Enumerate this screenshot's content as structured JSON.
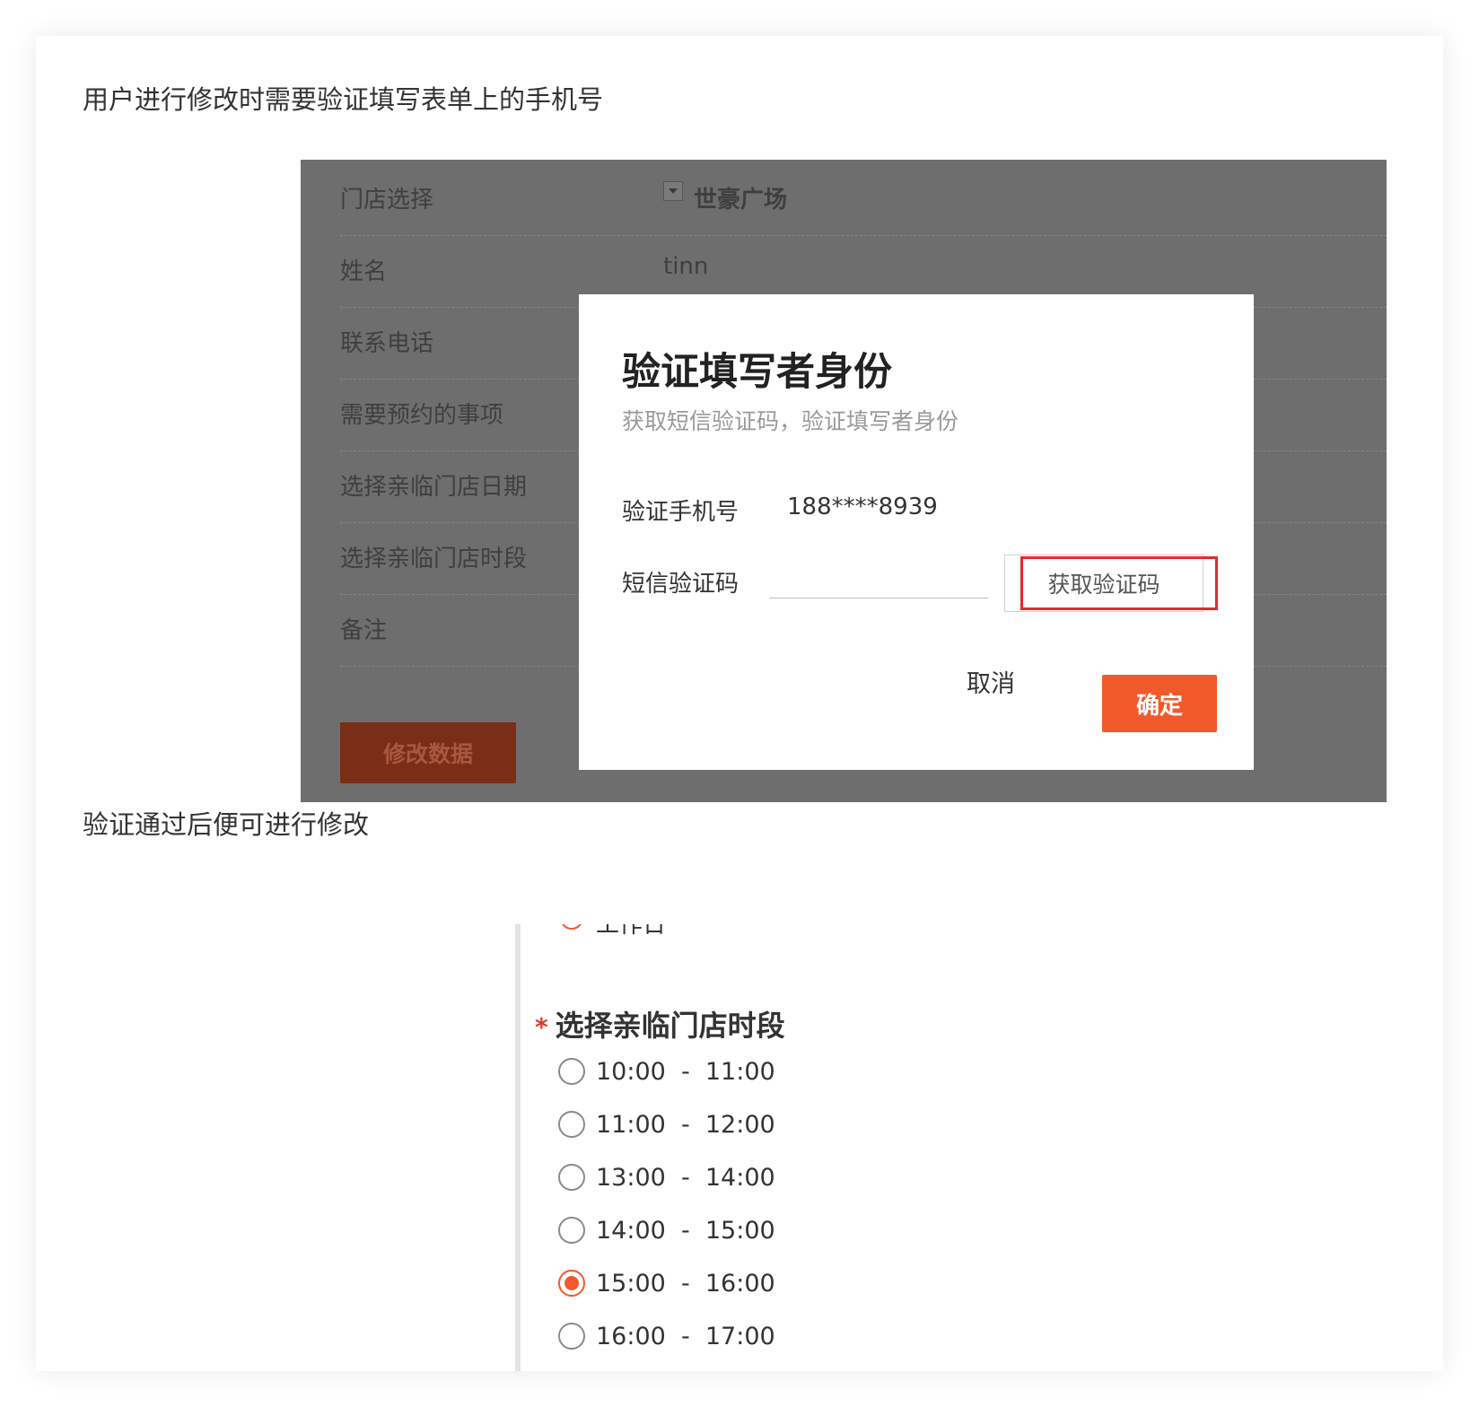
{
  "captions": {
    "first": "用户进行修改时需要验证填写表单上的手机号",
    "second": "验证通过后便可进行修改"
  },
  "form": {
    "rows": [
      {
        "label": "门店选择",
        "value": "世豪广场"
      },
      {
        "label": "姓名",
        "value": "tinn"
      },
      {
        "label": "联系电话",
        "value": ""
      },
      {
        "label": "需要预约的事项",
        "value": ""
      },
      {
        "label": "选择亲临门店日期",
        "value": ""
      },
      {
        "label": "选择亲临门店时段",
        "value": ""
      },
      {
        "label": "备注",
        "value": ""
      }
    ],
    "edit_button": "修改数据"
  },
  "modal": {
    "title": "验证填写者身份",
    "subtitle": "获取短信验证码，验证填写者身份",
    "phone_label": "验证手机号",
    "phone_value": "188****8939",
    "code_label": "短信验证码",
    "code_value": "",
    "get_code_button": "获取验证码",
    "cancel": "取消",
    "confirm": "确定"
  },
  "time_question": {
    "partial_prev_option": "工作日",
    "required_mark": "*",
    "title": "选择亲临门店时段",
    "options": [
      {
        "label": "10:00  -  11:00",
        "selected": false
      },
      {
        "label": "11:00  -  12:00",
        "selected": false
      },
      {
        "label": "13:00  -  14:00",
        "selected": false
      },
      {
        "label": "14:00  -  15:00",
        "selected": false
      },
      {
        "label": "15:00  -  16:00",
        "selected": true
      },
      {
        "label": "16:00  -  17:00",
        "selected": false
      }
    ]
  },
  "colors": {
    "accent": "#f05a2b",
    "highlight_box": "#e42b2b",
    "overlay": "#6e6e6e"
  }
}
